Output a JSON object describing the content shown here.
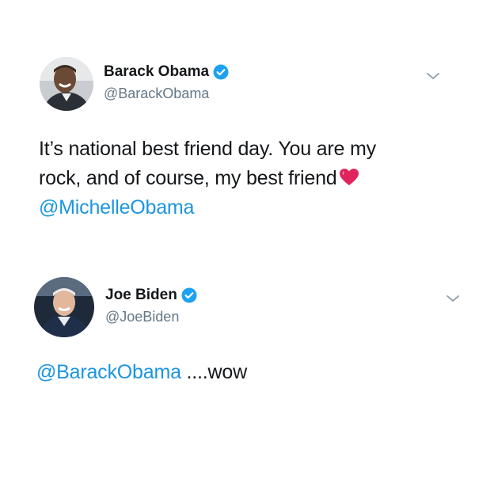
{
  "tweets": [
    {
      "author_name": "Barack Obama",
      "author_handle": "@BarackObama",
      "verified": true,
      "text_line1": "It’s national best friend day. You are my",
      "text_line2": "rock, and of course, my best friend",
      "text_mention": "@MichelleObama",
      "emoji": "red-heart"
    },
    {
      "author_name": "Joe Biden",
      "author_handle": "@JoeBiden",
      "verified": true,
      "text_mention": "@BarackObama",
      "text_rest": " ....wow"
    }
  ],
  "colors": {
    "mention": "#1b95e0",
    "verified_badge": "#1da1f2",
    "secondary_text": "#657786",
    "primary_text": "#14171a",
    "heart": "#e0245e"
  },
  "icons": [
    "verified-badge-icon",
    "chevron-down-icon",
    "red-heart-icon"
  ]
}
